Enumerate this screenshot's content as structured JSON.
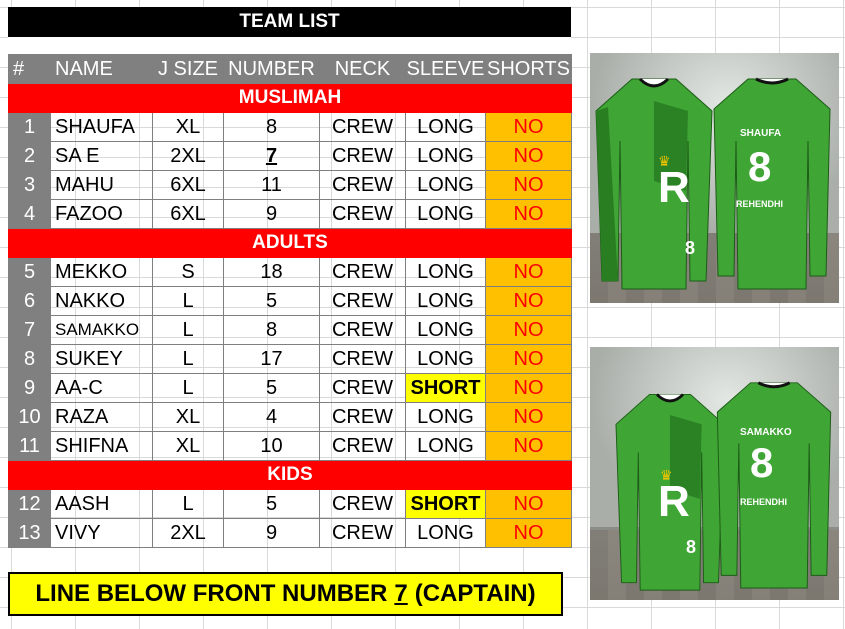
{
  "title": "TEAM LIST",
  "headers": [
    "#",
    "NAME",
    "J SIZE",
    "NUMBER",
    "NECK",
    "SLEEVE",
    "SHORTS"
  ],
  "sections": [
    {
      "label": "MUSLIMAH",
      "rows": [
        {
          "no": "1",
          "name": "SHAUFA",
          "size": "XL",
          "number": "8",
          "neck": "CREW",
          "sleeve": "LONG",
          "shorts": "NO"
        },
        {
          "no": "2",
          "name": "SA E",
          "size": "2XL",
          "number": "7",
          "neck": "CREW",
          "sleeve": "LONG",
          "shorts": "NO"
        },
        {
          "no": "3",
          "name": "MAHU",
          "size": "6XL",
          "number": "11",
          "neck": "CREW",
          "sleeve": "LONG",
          "shorts": "NO"
        },
        {
          "no": "4",
          "name": "FAZOO",
          "size": "6XL",
          "number": "9",
          "neck": "CREW",
          "sleeve": "LONG",
          "shorts": "NO"
        }
      ]
    },
    {
      "label": "ADULTS",
      "rows": [
        {
          "no": "5",
          "name": "MEKKO",
          "size": "S",
          "number": "18",
          "neck": "CREW",
          "sleeve": "LONG",
          "shorts": "NO"
        },
        {
          "no": "6",
          "name": "NAKKO",
          "size": "L",
          "number": "5",
          "neck": "CREW",
          "sleeve": "LONG",
          "shorts": "NO"
        },
        {
          "no": "7",
          "name": "SAMAKKO",
          "size": "L",
          "number": "8",
          "neck": "CREW",
          "sleeve": "LONG",
          "shorts": "NO"
        },
        {
          "no": "8",
          "name": "SUKEY",
          "size": "L",
          "number": "17",
          "neck": "CREW",
          "sleeve": "LONG",
          "shorts": "NO"
        },
        {
          "no": "9",
          "name": "AA-C",
          "size": "L",
          "number": "5",
          "neck": "CREW",
          "sleeve": "SHORT",
          "shorts": "NO"
        },
        {
          "no": "10",
          "name": "RAZA",
          "size": "XL",
          "number": "4",
          "neck": "CREW",
          "sleeve": "LONG",
          "shorts": "NO"
        },
        {
          "no": "11",
          "name": "SHIFNA",
          "size": "XL",
          "number": "10",
          "neck": "CREW",
          "sleeve": "LONG",
          "shorts": "NO"
        }
      ]
    },
    {
      "label": "KIDS",
      "rows": [
        {
          "no": "12",
          "name": "AASH",
          "size": "L",
          "number": "5",
          "neck": "CREW",
          "sleeve": "SHORT",
          "shorts": "NO"
        },
        {
          "no": "13",
          "name": "VIVY",
          "size": "2XL",
          "number": "9",
          "neck": "CREW",
          "sleeve": "LONG",
          "shorts": "NO"
        }
      ]
    }
  ],
  "note": {
    "before": "LINE BELOW FRONT NUMBER",
    "number": "7",
    "after": "(CAPTAIN)"
  },
  "mockups": [
    {
      "back_name": "SHAUFA",
      "back_number": "8",
      "back_sub": "REHENDHI",
      "front_number": "8",
      "logo": "R"
    },
    {
      "back_name": "SAMAKKO",
      "back_number": "8",
      "back_sub": "REHENDHI",
      "front_number": "8",
      "logo": "R"
    }
  ],
  "colors": {
    "jersey_green": "#3fa535",
    "section_red": "#ff0000",
    "shorts_orange": "#ffc000",
    "short_sleeve_yellow": "#ffff00",
    "header_gray": "#808080"
  }
}
